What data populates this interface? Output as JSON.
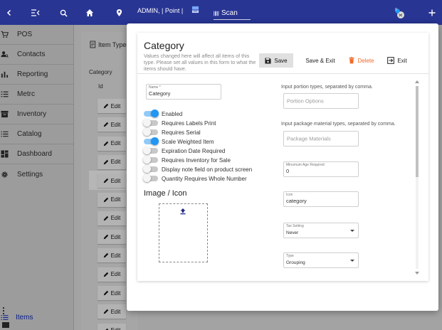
{
  "topbar": {
    "user_label": "ADMIN, | Point |",
    "scan_label": "Scan",
    "notification_count": "0"
  },
  "sidebar": {
    "items": [
      {
        "label": "POS",
        "icon": "cart-icon"
      },
      {
        "label": "Contacts",
        "icon": "contacts-icon"
      },
      {
        "label": "Reporting",
        "icon": "bar-chart-icon"
      },
      {
        "label": "Metrc",
        "icon": "list-icon"
      },
      {
        "label": "Inventory",
        "icon": "archive-icon"
      },
      {
        "label": "Catalog",
        "icon": "catalog-icon"
      },
      {
        "label": "Dashboard",
        "icon": "dashboard-icon"
      },
      {
        "label": "Settings",
        "icon": "gear-icon"
      }
    ],
    "active_link": "Items"
  },
  "background": {
    "tab_label": "Item Types",
    "category_label": "Category",
    "id_header": "Id",
    "edit_label": "Edit"
  },
  "modal": {
    "title": "Category",
    "subtitle": "Values changed here will affect all items of this type. Please set all values in this form to what the items should have.",
    "buttons": {
      "save": "Save",
      "save_exit": "Save & Exit",
      "delete": "Delete",
      "exit": "Exit"
    },
    "name_field": {
      "label": "Name *",
      "value": "Category"
    },
    "toggles": [
      {
        "label": "Enabled",
        "on": true
      },
      {
        "label": "Requires Labels Print",
        "on": false
      },
      {
        "label": "Requires Serial",
        "on": false
      },
      {
        "label": "Scale Weighted Item",
        "on": true
      },
      {
        "label": "Expiration Date Required",
        "on": false
      },
      {
        "label": "Requires Inventory for Sale",
        "on": false
      },
      {
        "label": "Display note field on product screen",
        "on": false
      },
      {
        "label": "Quantity Requires Whole Number",
        "on": false
      }
    ],
    "image_title": "Image / Icon",
    "portion_hint": "Input portion types, separated by comma.",
    "portion_placeholder": "Portion Options",
    "package_hint": "Input package material types, separated by comma.",
    "package_placeholder": "Package Materials",
    "min_age": {
      "label": "Minumum Age Required",
      "value": "0"
    },
    "icon_field": {
      "label": "Icon",
      "value": "category"
    },
    "tax_setting": {
      "label": "Tax Setting",
      "value": "Never"
    },
    "type_field": {
      "label": "Type",
      "value": "Grouping"
    }
  },
  "colors": {
    "topbar": "#283593",
    "accent": "#2196f3",
    "delete": "#f26b2b"
  }
}
